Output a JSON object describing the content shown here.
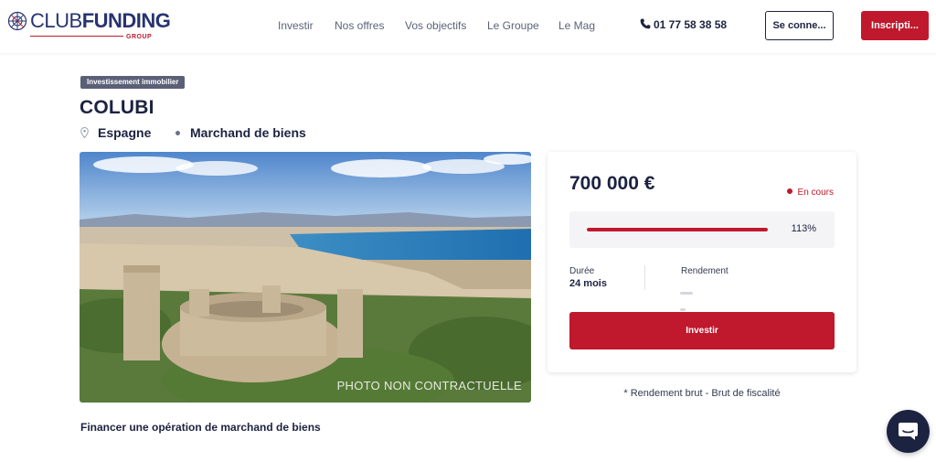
{
  "header": {
    "logo": {
      "club": "CLUB",
      "funding": "FUNDING",
      "group": "GROUP"
    },
    "nav": [
      {
        "label": "Investir"
      },
      {
        "label": "Nos offres"
      },
      {
        "label": "Vos objectifs"
      },
      {
        "label": "Le Groupe"
      },
      {
        "label": "Le Mag"
      }
    ],
    "phone": "01 77 58 38 58",
    "login_label": "Se conne...",
    "signup_label": "Inscripti..."
  },
  "project": {
    "tag": "Investissement immobilier",
    "title": "COLUBI",
    "country": "Espagne",
    "type": "Marchand de biens",
    "photo_caption": "PHOTO NON CONTRACTUELLE"
  },
  "card": {
    "amount": "700 000 €",
    "status": "En cours",
    "progress_percent": 113,
    "progress_label": "113%",
    "duration_label": "Durée",
    "duration_value": "24 mois",
    "yield_label": "Rendement",
    "invest_label": "Investir"
  },
  "footnote": "* Rendement brut - Brut de fiscalité",
  "section_heading": "Financer une opération de marchand de biens",
  "colors": {
    "primary": "#c0182c",
    "navy": "#1c2340",
    "tag_bg": "#5a6076"
  },
  "icons": [
    "logo-globe-icon",
    "phone-icon",
    "location-pin-icon",
    "chat-icon"
  ]
}
